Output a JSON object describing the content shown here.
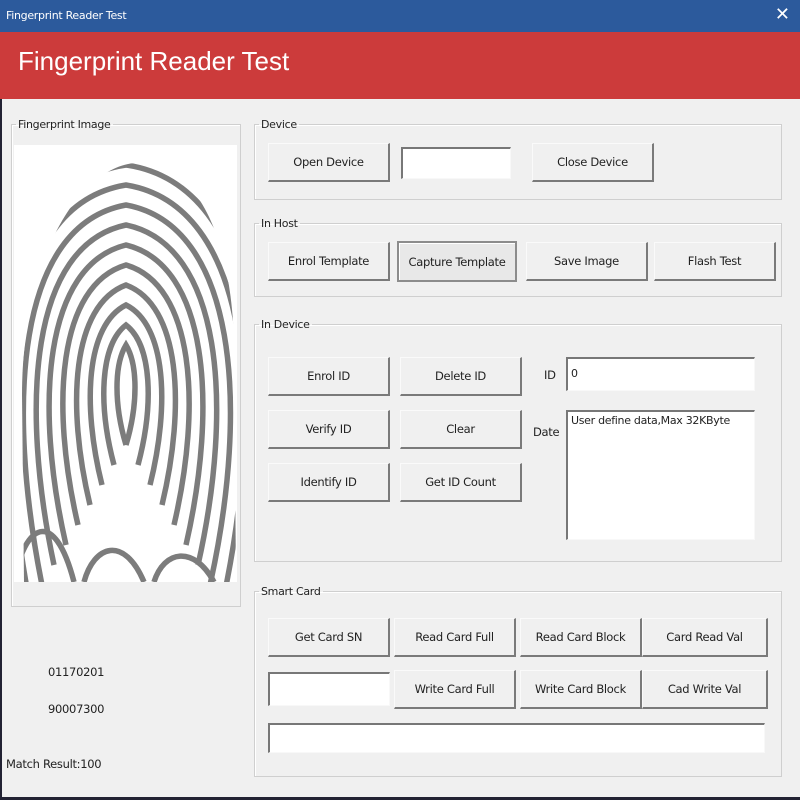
{
  "window": {
    "title": "Fingerprint Reader Test",
    "close_icon": "close-icon"
  },
  "header": {
    "title": "Fingerprint Reader Test",
    "colors": {
      "titlebar": "#2c5a9c",
      "banner": "#cc3b3b"
    }
  },
  "fingerprint": {
    "legend": "Fingerprint Image",
    "image": "fingerprint-image",
    "code_line_1": "01170201",
    "code_line_2": "90007300",
    "match_result": "Match Result:100"
  },
  "device": {
    "legend": "Device",
    "open_label": "Open Device",
    "status_value": "",
    "close_label": "Close Device"
  },
  "in_host": {
    "legend": "In Host",
    "buttons": [
      "Enrol Template",
      "Capture Template",
      "Save Image",
      "Flash Test"
    ],
    "pressed": "Capture Template"
  },
  "in_device": {
    "legend": "In Device",
    "buttons": [
      "Enrol ID",
      "Delete ID",
      "Verify ID",
      "Clear",
      "Identify ID",
      "Get ID Count"
    ],
    "id_label": "ID",
    "id_value": "0",
    "date_label": "Date",
    "date_value": "User define data,Max 32KByte"
  },
  "smart_card": {
    "legend": "Smart Card",
    "row1": [
      "Get Card SN",
      "Read Card Full",
      "Read Card Block",
      "Card Read Val"
    ],
    "row2": [
      "Write Card Full",
      "Write Card Block",
      "Cad Write Val"
    ],
    "sn_value": "",
    "data_value": ""
  }
}
